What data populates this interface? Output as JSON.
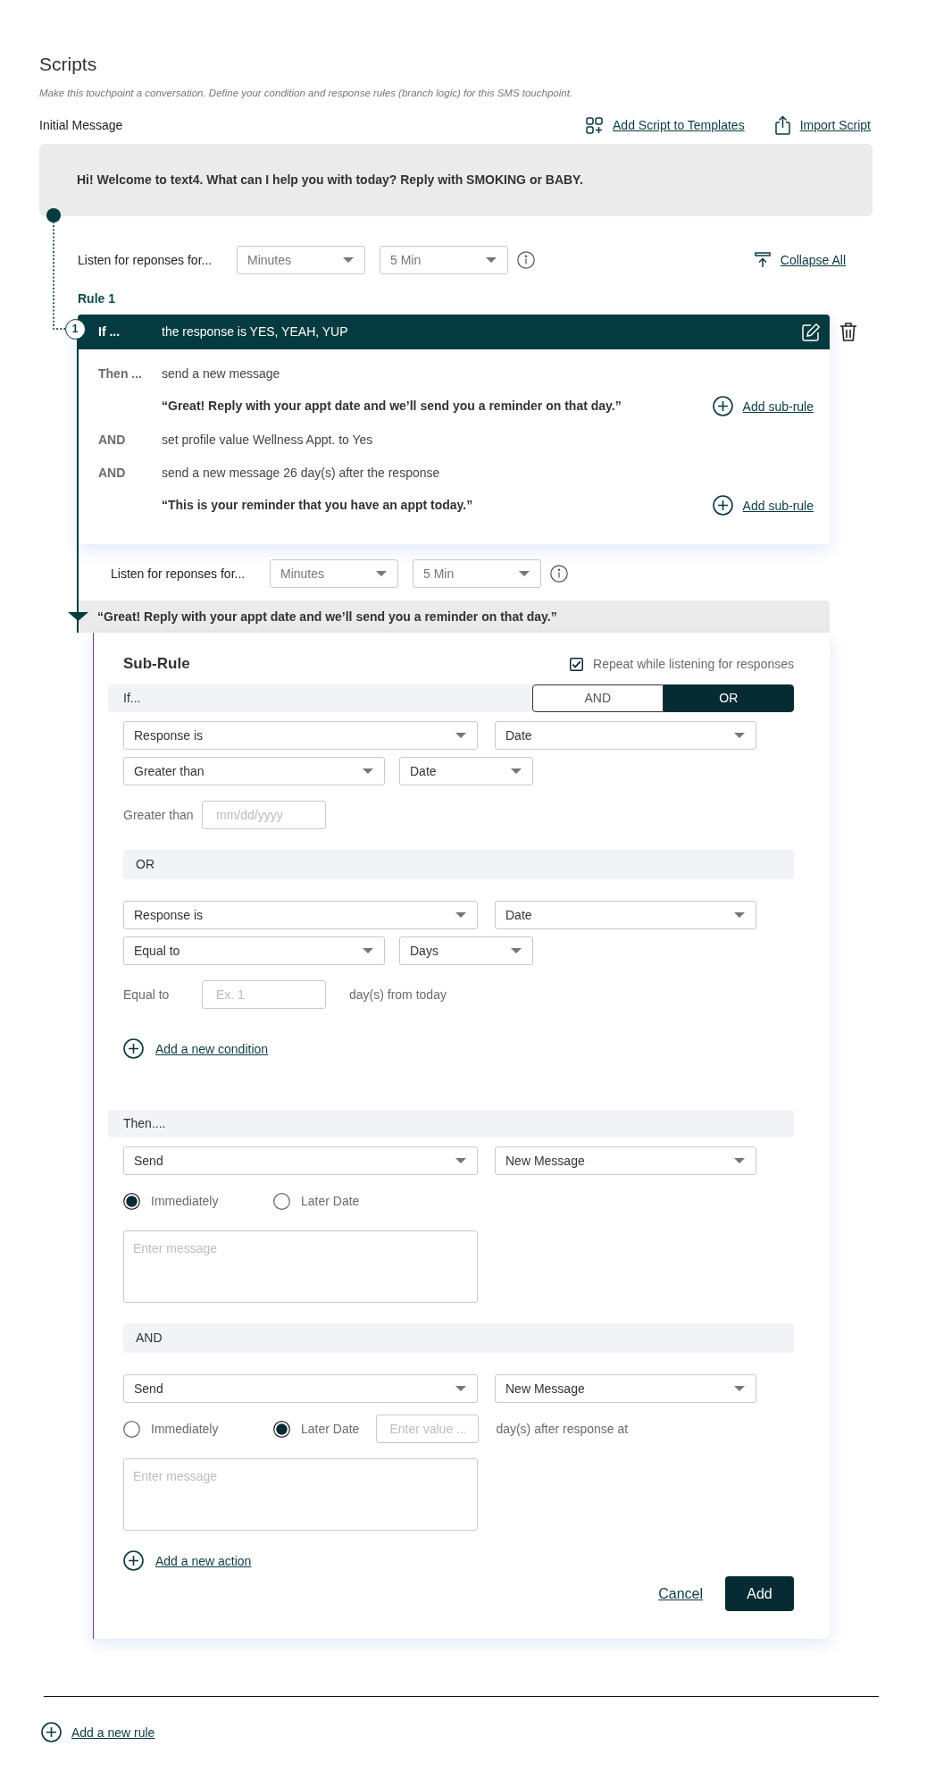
{
  "header": {
    "title": "Scripts",
    "description": "Make this touchpoint a conversation. Define your condition and response rules (branch logic) for this SMS touchpoint."
  },
  "initial_message": {
    "label": "Initial Message",
    "links": [
      {
        "kind": "templates",
        "label": "Add Script to Templates"
      },
      {
        "kind": "import",
        "label": "Import Script"
      }
    ],
    "text": "Hi! Welcome to text4. What can I help you with today? Reply with SMOKING or BABY."
  },
  "listen": {
    "label": "Listen for reponses for...",
    "unit": "Minutes",
    "duration": "5 Min"
  },
  "collapse_all": "Collapse All",
  "rule": {
    "title": "Rule 1",
    "number": "1",
    "if_label": "If ...",
    "condition": "the response is YES, YEAH, YUP",
    "actions": [
      {
        "label": "Then ...",
        "text": "send a new message",
        "message": "“Great! Reply with your appt date and we’ll send you a reminder on that day.”",
        "link": "Add sub-rule"
      },
      {
        "label": "AND",
        "text": "set profile value Wellness Appt. to Yes"
      },
      {
        "label": "AND",
        "text": "send a new message 26 day(s) after the response",
        "message": "“This is your reminder that you have an appt today.”",
        "link": "Add sub-rule"
      }
    ]
  },
  "sub_listen": {
    "label": "Listen for reponses for...",
    "unit": "Minutes",
    "duration": "5 Min"
  },
  "sub_rule": {
    "parent_message": "“Great! Reply with your appt date and we’ll send you a reminder on that day.”",
    "title": "Sub-Rule",
    "repeat": {
      "label": "Repeat while listening for responses",
      "checked": true
    },
    "if_label": "If...",
    "logic": [
      {
        "label": "AND",
        "selected": false
      },
      {
        "label": "OR",
        "selected": true
      }
    ],
    "conditions": [
      {
        "field": "Response is",
        "type": "Date",
        "operator": "Greater than",
        "operand": "Date",
        "value_label": "Greater than",
        "placeholder": "mm/dd/yyyy"
      },
      {
        "joiner": "OR",
        "field": "Response is",
        "type": "Date",
        "operator": "Equal to",
        "operand": "Days",
        "value_label": "Equal to",
        "placeholder": "Ex. 1",
        "suffix": "day(s) from today"
      }
    ],
    "add_condition": "Add a new condition",
    "then_label": "Then....",
    "actions": [
      {
        "action": "Send",
        "type": "New Message",
        "timing": [
          {
            "label": "Immediately",
            "selected": true
          },
          {
            "label": "Later Date",
            "selected": false
          }
        ],
        "message_placeholder": "Enter message"
      },
      {
        "joiner": "AND",
        "action": "Send",
        "type": "New Message",
        "timing": [
          {
            "label": "Immediately",
            "selected": false
          },
          {
            "label": "Later Date",
            "selected": true
          }
        ],
        "delay_placeholder": "Enter value ...",
        "delay_suffix": "day(s) after response at",
        "message_placeholder": "Enter message"
      }
    ],
    "add_action": "Add a new action",
    "cancel": "Cancel",
    "submit": "Add"
  },
  "add_rule": "Add a new rule"
}
